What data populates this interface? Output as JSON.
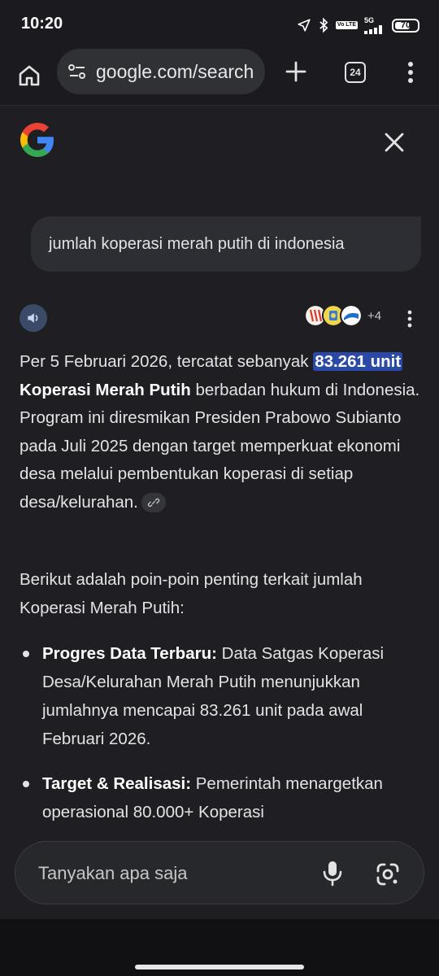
{
  "status_bar": {
    "time": "10:20",
    "network": "5G",
    "volte": "Vo LTE",
    "battery": "70",
    "battery_level": 0.7
  },
  "toolbar": {
    "url": "google.com/search",
    "tab_count": "24",
    "icons": [
      "home-icon",
      "site-settings-icon",
      "plus-icon",
      "tabs-icon",
      "more-vert-icon"
    ]
  },
  "header": {
    "logo": "google-g-logo",
    "close": "close-icon"
  },
  "query": {
    "text": "jumlah koperasi merah putih di indonesia"
  },
  "response_toolbar": {
    "sources_more": "+4"
  },
  "answer": {
    "p1_a": "Per 5 Februari 2026, tercatat sebanyak ",
    "p1_highlight": "83.261 unit",
    "p1_b": " ",
    "p1_bold": "Koperasi Merah Putih",
    "p1_c": " berbadan hukum di Indonesia. Program ini diresmikan Presiden Prabowo Subianto pada Juli 2025 dengan target memperkuat ekonomi desa melalui pembentukan koperasi di setiap desa/kelurahan.",
    "intro": "Berikut adalah poin-poin penting terkait jumlah Koperasi Merah Putih:",
    "bullets": [
      {
        "title": "Progres Data Terbaru:",
        "text": " Data Satgas Koperasi Desa/Kelurahan Merah Putih menunjukkan jumlahnya mencapai 83.261 unit pada awal Februari 2026."
      },
      {
        "title": "Target & Realisasi:",
        "text": " Pemerintah menargetkan operasional 80.000+ Koperasi"
      }
    ]
  },
  "input": {
    "placeholder": "Tanyakan apa saja"
  },
  "colors": {
    "background": "#1f1f23",
    "highlight": "#2b4aa8",
    "bubble": "#2d2e33"
  }
}
